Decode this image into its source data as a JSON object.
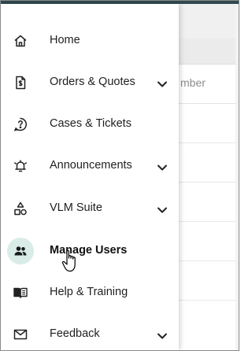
{
  "background": {
    "column_header": "mber"
  },
  "menu": {
    "items": [
      {
        "label": "Home",
        "icon": "home-icon",
        "expandable": false,
        "active": false
      },
      {
        "label": "Orders & Quotes",
        "icon": "dollar-document-icon",
        "expandable": true,
        "active": false
      },
      {
        "label": "Cases & Tickets",
        "icon": "help-circle-icon",
        "expandable": false,
        "active": false
      },
      {
        "label": "Announcements",
        "icon": "bell-icon",
        "expandable": true,
        "active": false
      },
      {
        "label": "VLM Suite",
        "icon": "shapes-icon",
        "expandable": true,
        "active": false
      },
      {
        "label": "Manage Users",
        "icon": "users-icon",
        "expandable": false,
        "active": true
      },
      {
        "label": "Help & Training",
        "icon": "book-icon",
        "expandable": false,
        "active": false
      },
      {
        "label": "Feedback",
        "icon": "mail-icon",
        "expandable": true,
        "active": false
      }
    ]
  },
  "colors": {
    "active_highlight": "#d9ece8",
    "top_bar": "#2f4a4f",
    "text": "#1f1f1f"
  }
}
